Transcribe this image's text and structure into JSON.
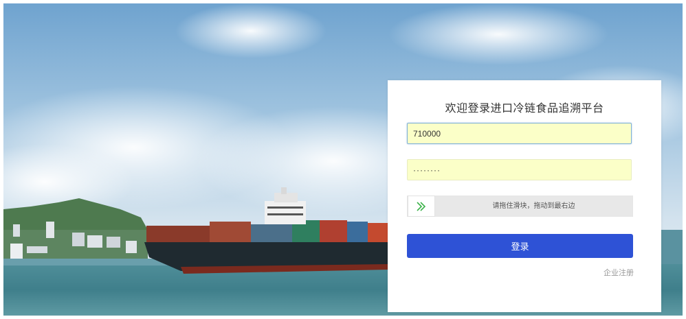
{
  "login": {
    "title": "欢迎登录进口冷链食品追溯平台",
    "username_value": "710000",
    "password_value": "········",
    "slider_text": "请拖住滑块，拖动到最右边",
    "login_button": "登录",
    "register_link": "企业注册"
  },
  "icons": {
    "slider_handle": "double-chevron-right-icon"
  },
  "colors": {
    "accent": "#2e52d6",
    "input_autofill": "#fbffc8",
    "slider_chevron": "#3cb34a",
    "title_text": "#333333",
    "link_text": "#999999"
  }
}
